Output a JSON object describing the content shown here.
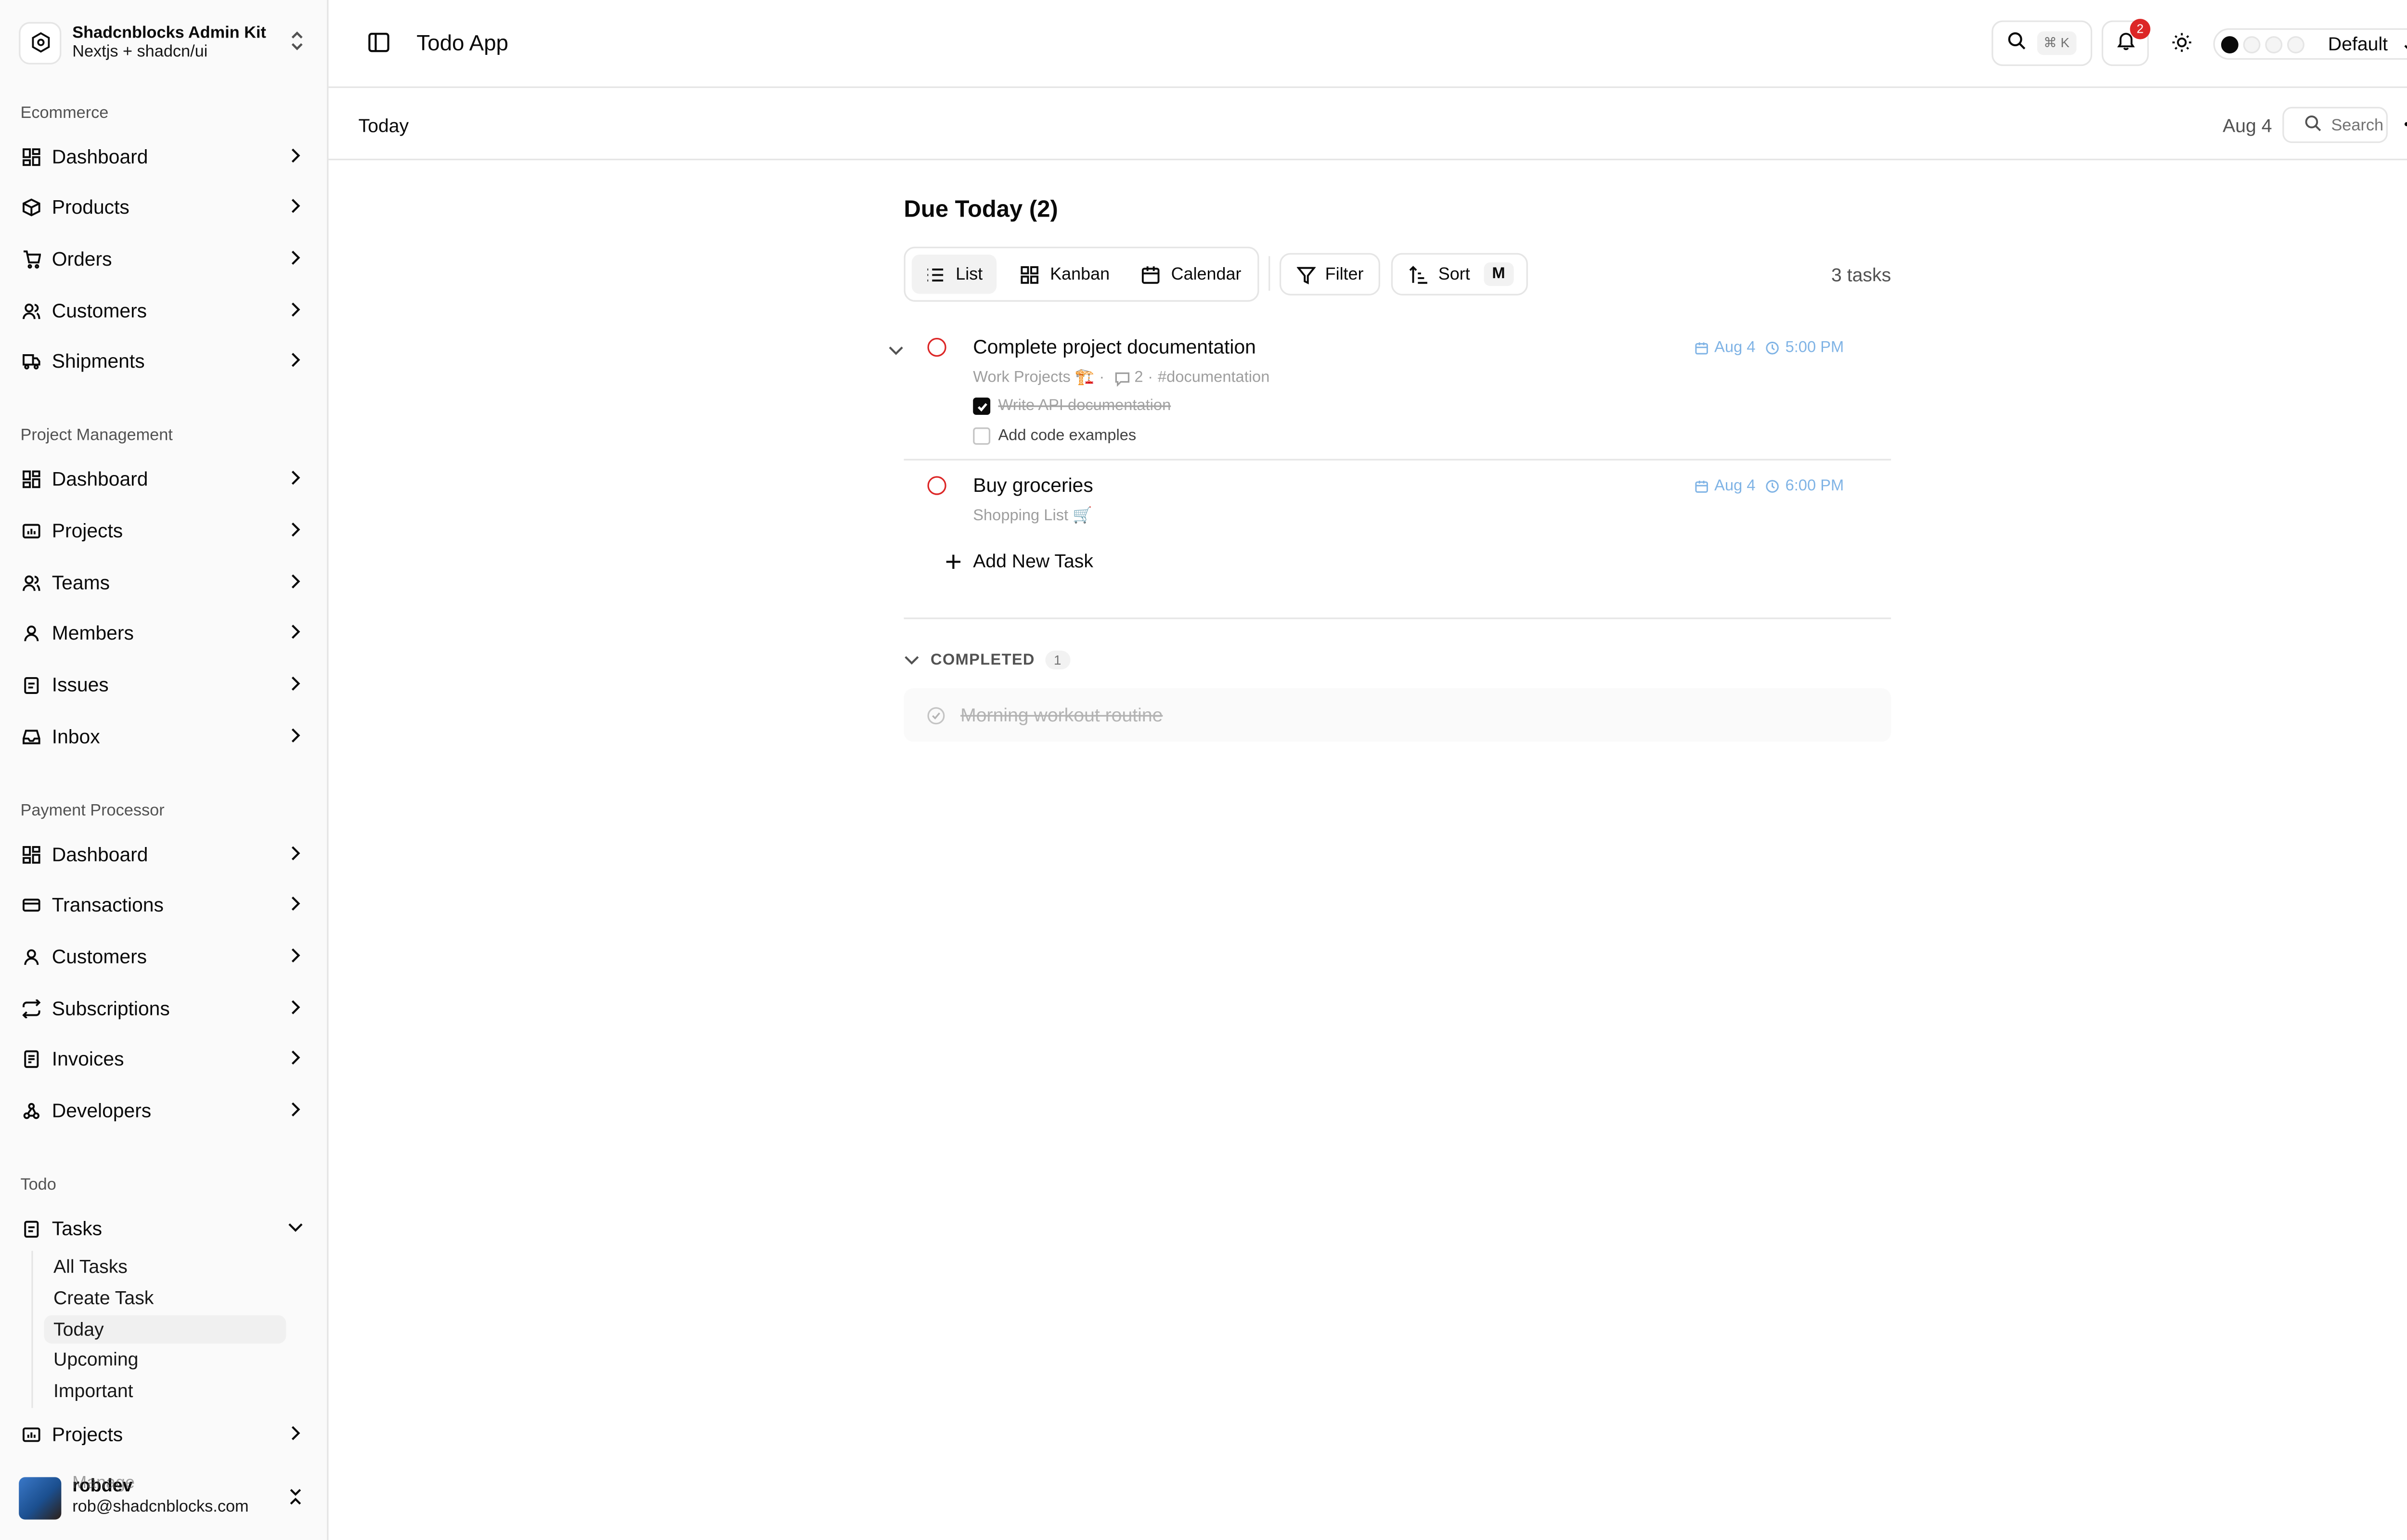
{
  "brand": {
    "title": "Shadcnblocks Admin Kit",
    "subtitle": "Nextjs + shadcn/ui"
  },
  "sidebar": {
    "ecommerce": {
      "label": "Ecommerce",
      "items": [
        "Dashboard",
        "Products",
        "Orders",
        "Customers",
        "Shipments"
      ]
    },
    "project_management": {
      "label": "Project Management",
      "items": [
        "Dashboard",
        "Projects",
        "Teams",
        "Members",
        "Issues",
        "Inbox"
      ]
    },
    "payment": {
      "label": "Payment Processor",
      "items": [
        "Dashboard",
        "Transactions",
        "Customers",
        "Subscriptions",
        "Invoices",
        "Developers"
      ]
    },
    "todo": {
      "label": "Todo",
      "tasks_label": "Tasks",
      "sub_items": [
        "All Tasks",
        "Create Task",
        "Today",
        "Upcoming",
        "Important"
      ],
      "projects_label": "Projects",
      "manage_label": "Manage"
    }
  },
  "user": {
    "name": "shadcnblocks",
    "display": "robdev",
    "email": "rob@shadcnblocks.com"
  },
  "header": {
    "title": "Todo App",
    "kbd": "⌘ K",
    "notifications": "2",
    "theme": "Default"
  },
  "subbar": {
    "title": "Today",
    "date": "Aug 4",
    "search_placeholder": "Search"
  },
  "main": {
    "heading": "Due Today (2)",
    "views": [
      "List",
      "Kanban",
      "Calendar"
    ],
    "filter": "Filter",
    "sort": "Sort",
    "sort_kbd": "M",
    "count": "3 tasks",
    "tasks": [
      {
        "title": "Complete project documentation",
        "project": "Work Projects 🏗️",
        "comments": "2",
        "tag": "#documentation",
        "date": "Aug 4",
        "time": "5:00 PM",
        "subtasks": [
          {
            "label": "Write API documentation",
            "done": true
          },
          {
            "label": "Add code examples",
            "done": false
          }
        ]
      },
      {
        "title": "Buy groceries",
        "project": "Shopping List 🛒",
        "date": "Aug 4",
        "time": "6:00 PM"
      }
    ],
    "add_task": "Add New Task",
    "completed_label": "COMPLETED",
    "completed_count": "1",
    "completed": [
      "Morning workout routine"
    ]
  },
  "colors": {
    "accent": "#0a0a0a",
    "danger": "#dc2626",
    "due": "#7fb3e5",
    "border": "#e5e5e5"
  }
}
